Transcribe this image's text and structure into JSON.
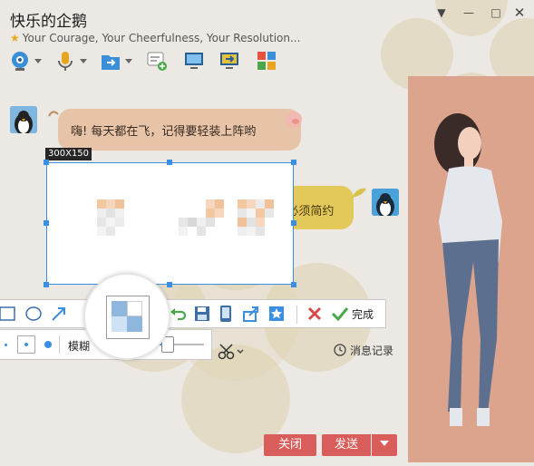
{
  "window": {
    "title": "快乐的企鹅",
    "signature": "Your Courage, Your Cheerfulness, Your Resolution..."
  },
  "messages": [
    {
      "text": "嗨! 每天都在飞，记得要轻装上阵哟"
    },
    {
      "text": "4 必须简约"
    }
  ],
  "screenshot": {
    "size_label": "300X150"
  },
  "edit_toolbar": {
    "done_label": "完成"
  },
  "mosaic_options": {
    "label": "模糊"
  },
  "chat_footer": {
    "history_label": "消息记录",
    "close_label": "关闭",
    "send_label": "发送"
  }
}
